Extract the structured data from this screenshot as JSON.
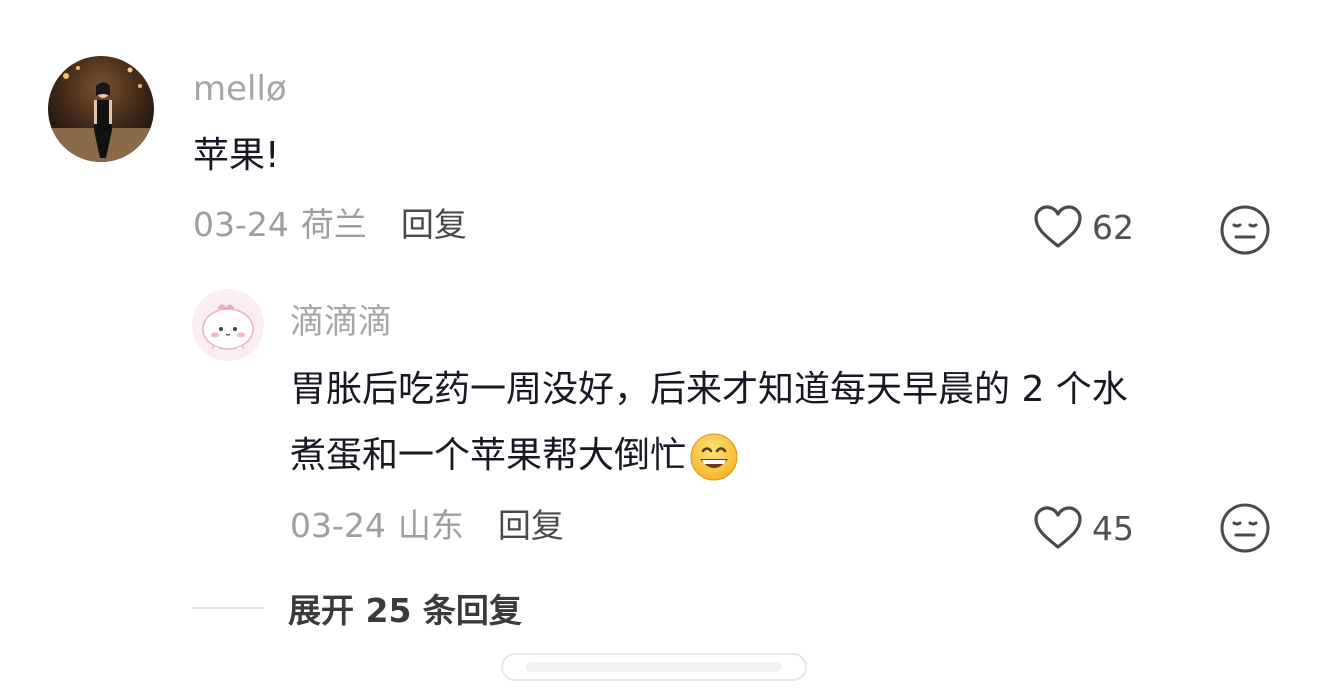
{
  "comments": [
    {
      "username": "mellø",
      "text": "苹果!",
      "date": "03-24",
      "location": "荷兰",
      "reply_label": "回复",
      "likes": "62",
      "avatar_icon": "photo-avatar-icon"
    },
    {
      "username": "滴滴滴",
      "text_line1": "胃胀后吃药一周没好，后来才知道每天早晨的 2 个水",
      "text_line2": "煮蛋和一个苹果帮大倒忙",
      "date": "03-24",
      "location": "山东",
      "reply_label": "回复",
      "likes": "45",
      "avatar_icon": "pink-cartoon-avatar-icon",
      "emoji": "grinning-face-icon"
    }
  ],
  "expand_replies": {
    "label": "展开 25 条回复"
  },
  "colors": {
    "username": "#a6a6a6",
    "text": "#161823",
    "meta": "#9e9e9e",
    "icon": "#4a4a4a"
  }
}
